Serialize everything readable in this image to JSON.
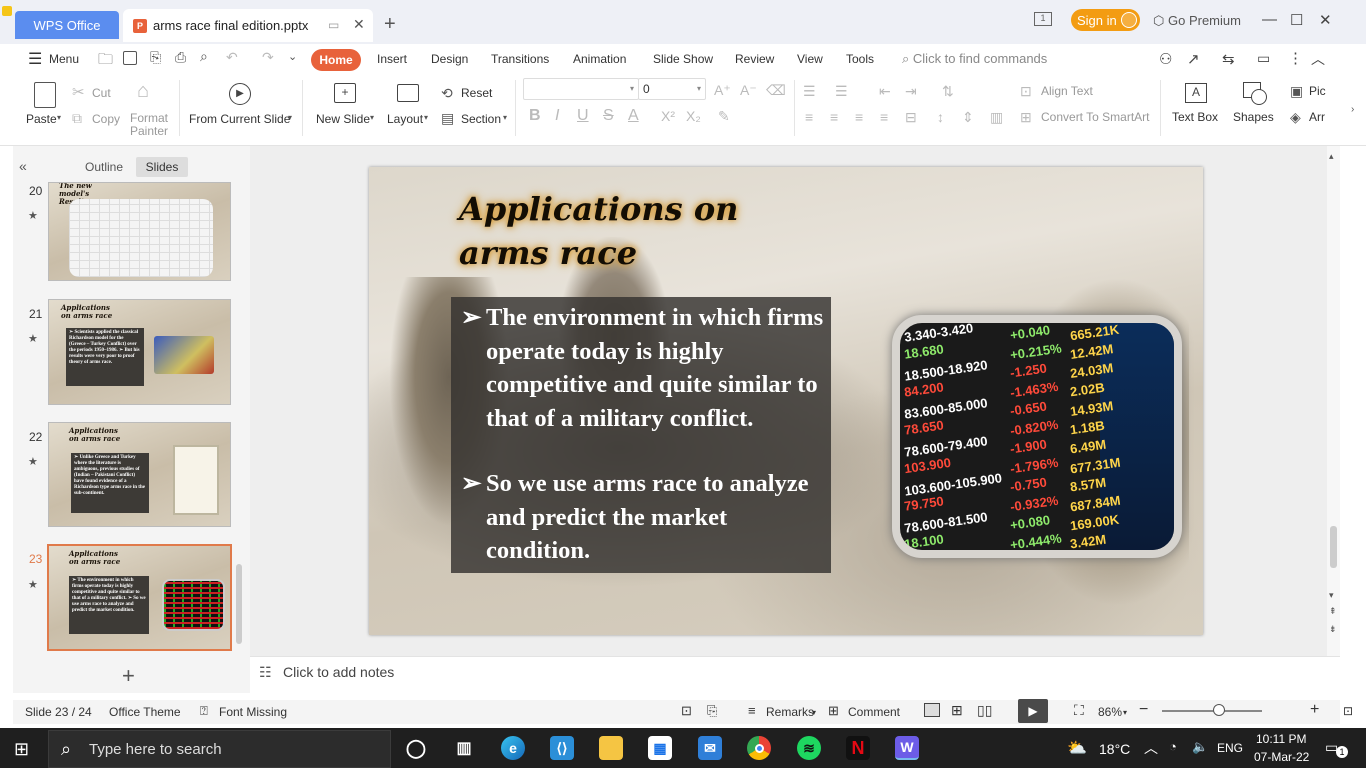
{
  "titlebar": {
    "app_tab": "WPS Office",
    "doc_tab": "arms race final edition.pptx",
    "file_icon_letter": "P",
    "sign_in": "Sign in",
    "go_premium": "Go Premium"
  },
  "menu": {
    "menu_label": "Menu",
    "tabs": [
      "Home",
      "Insert",
      "Design",
      "Transitions",
      "Animation",
      "Slide Show",
      "Review",
      "View",
      "Tools"
    ],
    "find_commands": "Click to find commands"
  },
  "ribbon": {
    "paste": "Paste",
    "cut": "Cut",
    "copy": "Copy",
    "format_painter": "Format Painter",
    "from_current_slide": "From Current Slide",
    "new_slide": "New Slide",
    "layout": "Layout",
    "reset": "Reset",
    "section": "Section",
    "font_size": "0",
    "align_text": "Align Text",
    "convert_smartart": "Convert To SmartArt",
    "text_box": "Text Box",
    "shapes": "Shapes",
    "picture": "Pic",
    "arrange": "Arr"
  },
  "left_panel": {
    "outline_tab": "Outline",
    "slides_tab": "Slides",
    "thumbnails": [
      {
        "number": "20",
        "title": "The new model's Results",
        "text": ""
      },
      {
        "number": "21",
        "title": "Applications on arms race",
        "text": "➢ Scientists applied the classical Richardson model for the (Greece – Turkey Conflict) over the periods 1950–1986. ➢ But his results were very poor to proof theory of arms race."
      },
      {
        "number": "22",
        "title": "Applications on arms race",
        "text": "➢ Unlike Greece and Turkey where the literature is ambiguous, previous studies of (Indian – Pakistani Conflict) have found evidence of a Richardson type arms race in the sub-continent."
      },
      {
        "number": "23",
        "title": "Applications on arms race",
        "text": "➢ The environment in which firms operate today is highly competitive and quite similar to that of a military conflict. ➢ So we use arms race to analyze and predict the market condition."
      }
    ]
  },
  "slide": {
    "title_line1": "Applications on",
    "title_line2": "arms race",
    "bullets": [
      "The environment in which firms operate today is highly competitive and quite similar to that of a military conflict.",
      "So we use arms race to analyze and predict the market condition."
    ],
    "bullet_glyph": "➢",
    "stock_rows": [
      {
        "a": "3.340-3.420",
        "b": "+0.040",
        "c": "665.21K",
        "cb": "#8eea6b"
      },
      {
        "a": "18.680",
        "b": "+0.215%",
        "c": "12.42M",
        "cb": "#8eea6b"
      },
      {
        "a": "18.500-18.920",
        "b": "-1.250",
        "c": "24.03M",
        "cb": "#ff4a3a"
      },
      {
        "a": "84.200",
        "b": "-1.463%",
        "c": "2.02B",
        "cb": "#ff4a3a"
      },
      {
        "a": "83.600-85.000",
        "b": "-0.650",
        "c": "14.93M",
        "cb": "#ff4a3a"
      },
      {
        "a": "78.650",
        "b": "-0.820%",
        "c": "1.18B",
        "cb": "#ff4a3a"
      },
      {
        "a": "78.600-79.400",
        "b": "-1.900",
        "c": "6.49M",
        "cb": "#ff4a3a"
      },
      {
        "a": "103.900",
        "b": "-1.796%",
        "c": "677.31M",
        "cb": "#ff4a3a"
      },
      {
        "a": "103.600-105.900",
        "b": "-0.750",
        "c": "8.57M",
        "cb": "#ff4a3a"
      },
      {
        "a": "79.750",
        "b": "-0.932%",
        "c": "687.84M",
        "cb": "#ff4a3a"
      },
      {
        "a": "78.600-81.500",
        "b": "+0.080",
        "c": "169.00K",
        "cb": "#8eea6b"
      },
      {
        "a": "18.100",
        "b": "+0.444%",
        "c": "3.42M",
        "cb": "#8eea6b"
      }
    ]
  },
  "notes": {
    "placeholder": "Click to add notes"
  },
  "status": {
    "slide_counter": "Slide 23 / 24",
    "theme": "Office Theme",
    "font_missing": "Font Missing",
    "remarks": "Remarks",
    "comment": "Comment",
    "zoom": "86%"
  },
  "taskbar": {
    "search_placeholder": "Type here to search",
    "weather": "18°C",
    "language": "ENG",
    "time": "10:11 PM",
    "date": "07-Mar-22",
    "notification_count": "1"
  },
  "colors": {
    "accent": "#e8623b",
    "wps_blue": "#5b8def",
    "signin_orange": "#f39c12",
    "selected_thumb": "#e07a4a"
  }
}
